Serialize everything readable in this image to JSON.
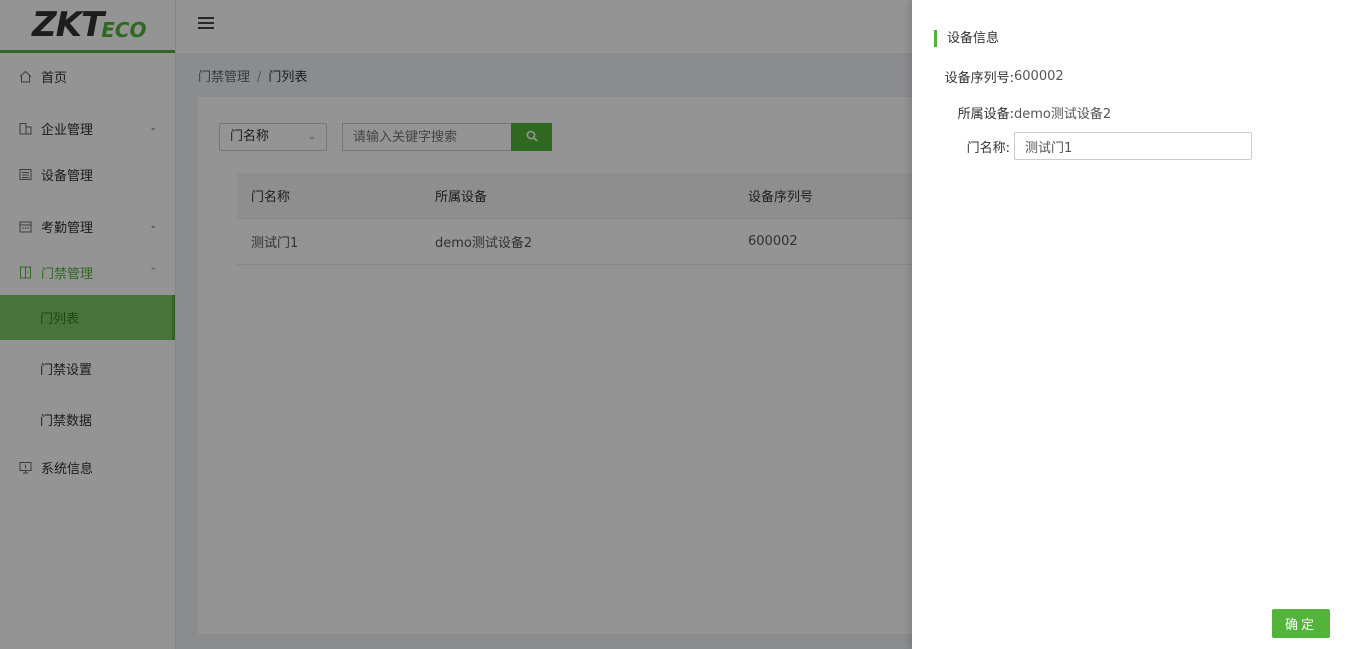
{
  "logo": {
    "zk": "ZKT",
    "eco": "ECO"
  },
  "sidebar": {
    "items": [
      {
        "label": "首页",
        "icon": "home-icon"
      },
      {
        "label": "企业管理",
        "icon": "building-icon"
      },
      {
        "label": "设备管理",
        "icon": "device-icon"
      },
      {
        "label": "考勤管理",
        "icon": "calendar-icon"
      },
      {
        "label": "门禁管理",
        "icon": "door-icon"
      },
      {
        "label": "系统信息",
        "icon": "monitor-icon"
      }
    ],
    "sub_items": [
      {
        "label": "门列表"
      },
      {
        "label": "门禁设置"
      },
      {
        "label": "门禁数据"
      }
    ]
  },
  "breadcrumb": {
    "parent": "门禁管理",
    "separator": "/",
    "current": "门列表"
  },
  "filter": {
    "select_value": "门名称",
    "search_placeholder": "请输入关键字搜索"
  },
  "table": {
    "columns": [
      "门名称",
      "所属设备",
      "设备序列号"
    ],
    "rows": [
      [
        "测试门1",
        "demo测试设备2",
        "600002"
      ]
    ]
  },
  "drawer": {
    "title": "设备信息",
    "serial_label": "设备序列号:",
    "serial_value": "600002",
    "device_label": "所属设备:",
    "device_value": "demo测试设备2",
    "door_label": "门名称:",
    "door_value": "测试门1",
    "confirm_label": "确定"
  },
  "colors": {
    "accent": "#52b43a"
  }
}
